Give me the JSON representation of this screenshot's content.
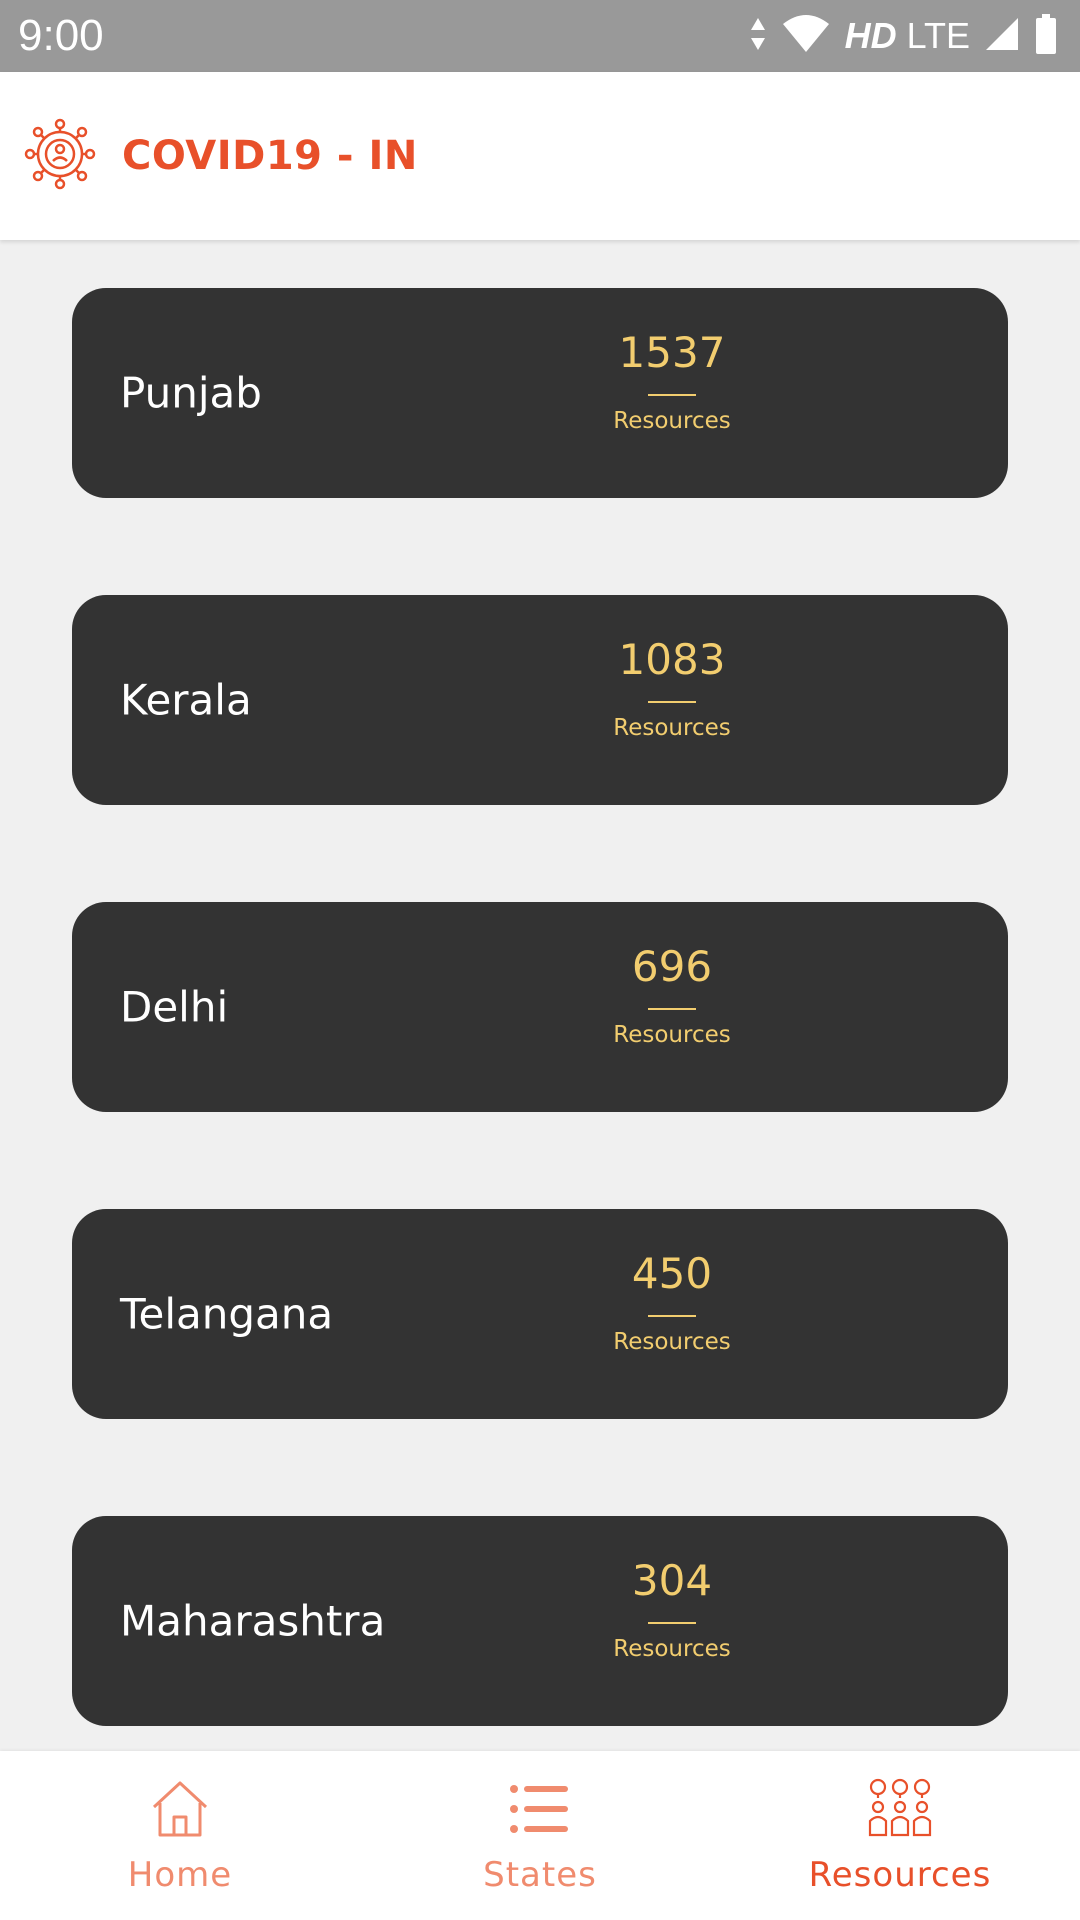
{
  "status_bar": {
    "time": "9:00",
    "network_hd": "HD",
    "network_type": "LTE",
    "icons": [
      "data-arrows-icon",
      "wifi-icon",
      "signal-icon",
      "battery-icon"
    ]
  },
  "app_bar": {
    "logo_icon": "virus-network-icon",
    "title": "COVID19 - IN"
  },
  "resources_list": {
    "items": [
      {
        "state": "Punjab",
        "count": "1537",
        "label": "Resources"
      },
      {
        "state": "Kerala",
        "count": "1083",
        "label": "Resources"
      },
      {
        "state": "Delhi",
        "count": "696",
        "label": "Resources"
      },
      {
        "state": "Telangana",
        "count": "450",
        "label": "Resources"
      },
      {
        "state": "Maharashtra",
        "count": "304",
        "label": "Resources"
      }
    ]
  },
  "bottom_nav": {
    "items": [
      {
        "label": "Home",
        "icon": "home-icon",
        "active": false
      },
      {
        "label": "States",
        "icon": "list-icon",
        "active": false
      },
      {
        "label": "Resources",
        "icon": "people-icon",
        "active": true
      }
    ]
  },
  "colors": {
    "accent": "#e8502a",
    "accent_light": "#f08b6e",
    "card_bg": "#333333",
    "count_text": "#f2cd6f",
    "page_bg": "#f0f0f0",
    "status_bar": "#999999"
  }
}
